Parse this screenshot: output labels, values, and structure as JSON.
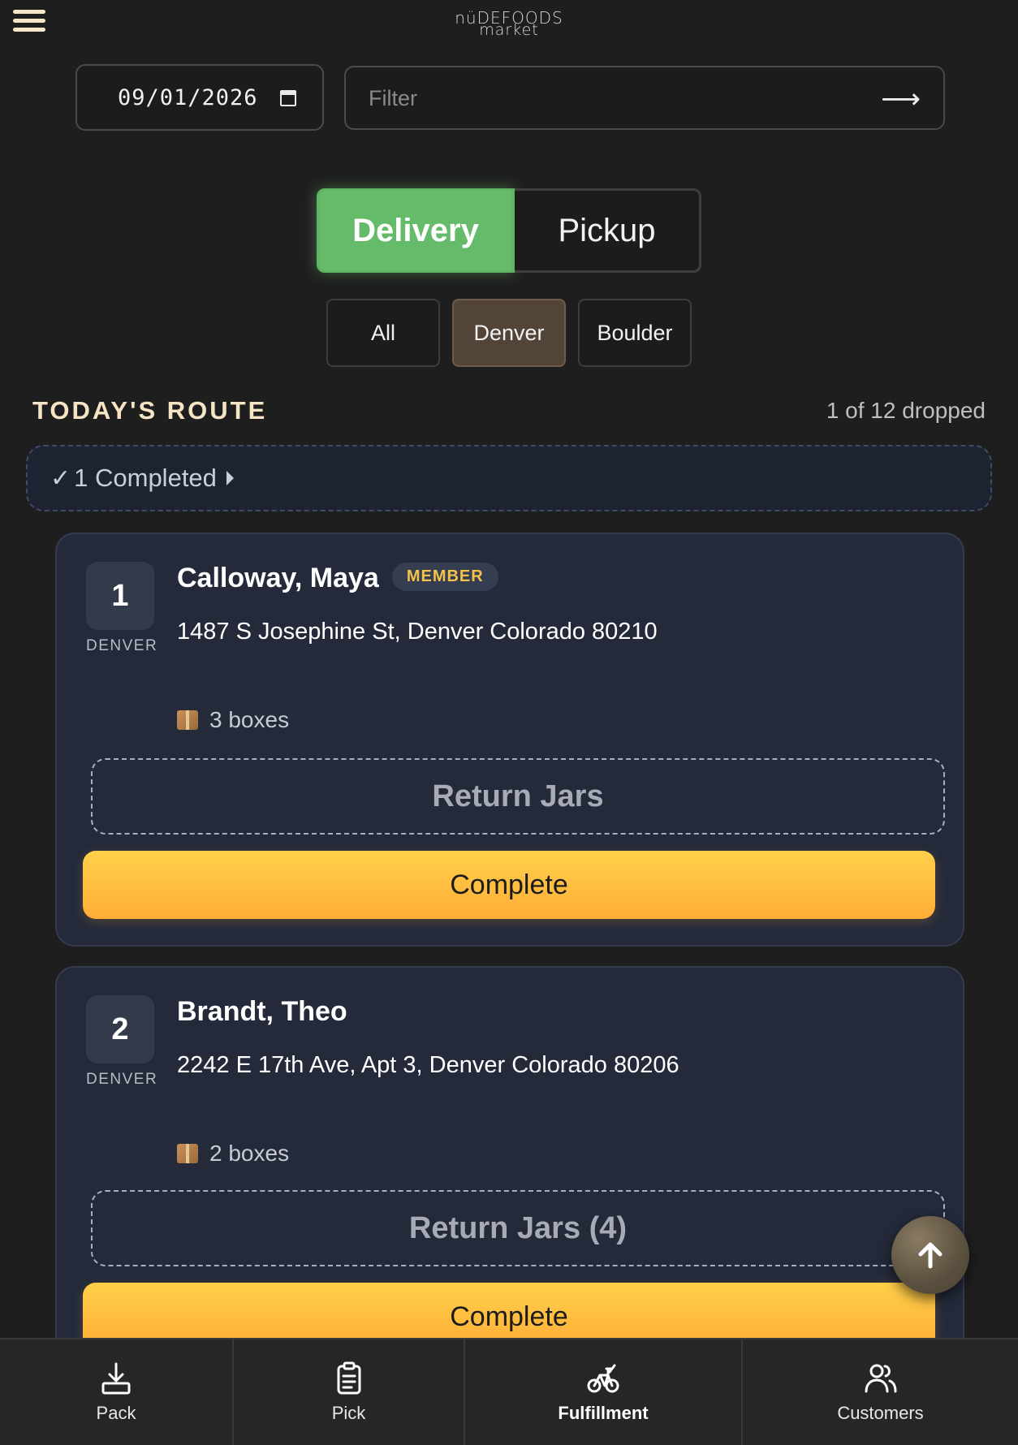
{
  "header": {
    "logo_top": "nüDEFOODS",
    "logo_bottom": "market"
  },
  "filters": {
    "date_value": "09/01/2026",
    "filter_placeholder": "Filter"
  },
  "mode_toggle": {
    "delivery_label": "Delivery",
    "pickup_label": "Pickup",
    "selected": "Delivery"
  },
  "regions": {
    "items": [
      {
        "label": "All"
      },
      {
        "label": "Denver"
      },
      {
        "label": "Boulder"
      }
    ],
    "selected": "Denver"
  },
  "route": {
    "title": "TODAY'S ROUTE",
    "dropped_status": "1 of 12 dropped",
    "completed_check": "✓",
    "completed_label": "1 Completed"
  },
  "stops": [
    {
      "number": "1",
      "city": "DENVER",
      "name": "Calloway, Maya",
      "badge": "MEMBER",
      "address": "1487 S Josephine St, Denver Colorado 80210",
      "boxes": "3 boxes",
      "return_label": "Return Jars",
      "complete_label": "Complete"
    },
    {
      "number": "2",
      "city": "DENVER",
      "name": "Brandt, Theo",
      "address": "2242 E 17th Ave, Apt 3, Denver Colorado 80206",
      "boxes": "2 boxes",
      "return_label": "Return Jars (4)",
      "complete_label": "Complete"
    }
  ],
  "bottom_nav": {
    "items": [
      {
        "label": "Pack",
        "icon": "pack-download-icon"
      },
      {
        "label": "Pick",
        "icon": "clipboard-icon"
      },
      {
        "label": "Fulfillment",
        "icon": "bicycle-icon"
      },
      {
        "label": "Customers",
        "icon": "users-icon"
      }
    ],
    "active": "Fulfillment"
  },
  "colors": {
    "delivery_green": "#66bb6a",
    "complete_yellow": "#ffc13f",
    "member_gold": "#f4c24a",
    "region_active": "#524538",
    "card_bg": "#242a3a"
  }
}
